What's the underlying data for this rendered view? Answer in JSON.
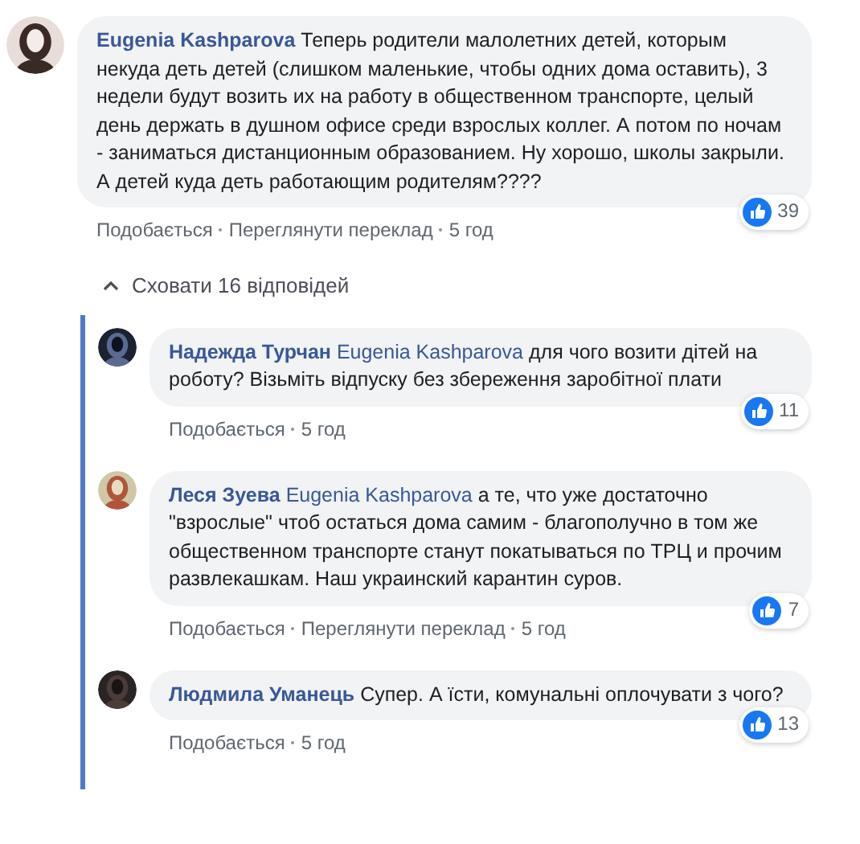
{
  "comment": {
    "author": "Eugenia Kashparova",
    "text": "Теперь родители малолетних детей, которым некуда деть детей (слишком маленькие, чтобы одних дома оставить), 3 недели будут возить их на работу в общественном транспорте, целый день держать в душном офисе среди взрослых коллег. А потом по ночам - заниматься дистанционным образованием. Ну хорошо, школы закрыли. А детей куда деть работающим родителям????",
    "reactions": "39",
    "actions": [
      "Подобається",
      "Переглянути переклад"
    ],
    "time": "5 год",
    "avatar": {
      "kind": "picture"
    }
  },
  "toggle_replies": {
    "label": "Сховати 16 відповідей",
    "expanded": true
  },
  "replies": [
    {
      "author": "Надежда Турчан",
      "mention": "Eugenia Kashparova",
      "text": "для чого возити дітей на роботу? Візьміть відпуску без збереження заробітної плати",
      "reactions": "11",
      "actions": [
        "Подобається"
      ],
      "time": "5 год",
      "avatar": {
        "kind": "picture"
      }
    },
    {
      "author": "Леся Зуева",
      "mention": "Eugenia Kashparova",
      "text": "а те, что уже достаточно \"взрослые\" чтоб остаться дома самим - благополучно в том же общественном транспорте станут покатываться по ТРЦ и прочим развлекашкам. Наш украинский карантин суров.",
      "reactions": "7",
      "actions": [
        "Подобається",
        "Переглянути переклад"
      ],
      "time": "5 год",
      "avatar": {
        "kind": "picture"
      }
    },
    {
      "author": "Людмила Уманець",
      "text": "Супер. А їсти, комунальні оплочувати з чого?",
      "reactions": "13",
      "actions": [
        "Подобається"
      ],
      "time": "5 год",
      "avatar": {
        "kind": "picture"
      }
    }
  ]
}
